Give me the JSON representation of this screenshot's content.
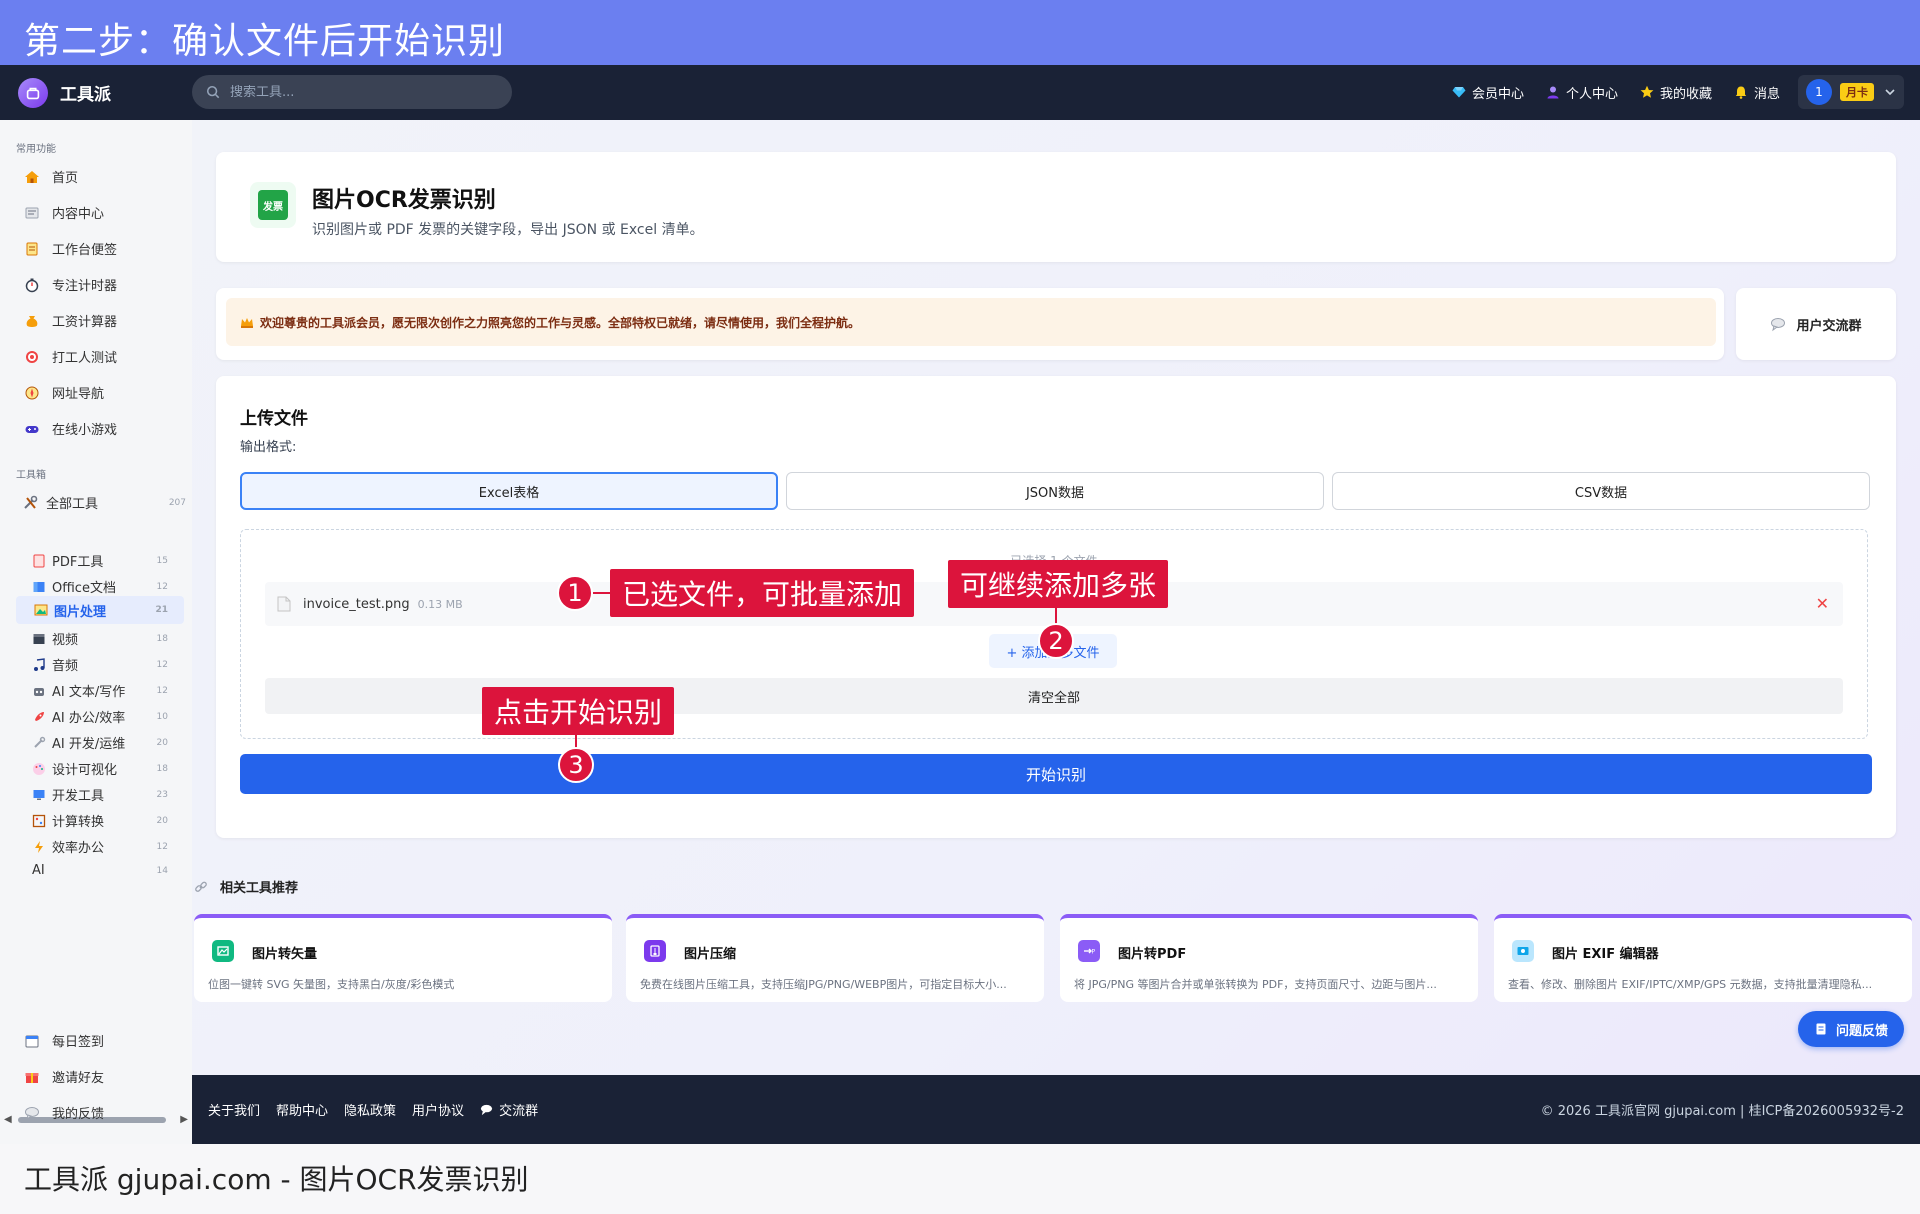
{
  "banner": {
    "text": "第二步：确认文件后开始识别"
  },
  "caption": {
    "text": "工具派 gjupai.com - 图片OCR发票识别"
  },
  "topnav": {
    "logo_text": "工具派",
    "search_placeholder": "搜索工具...",
    "items": [
      {
        "label": "会员中心",
        "icon": "diamond-icon",
        "color": "#38bdf8"
      },
      {
        "label": "个人中心",
        "icon": "user-icon",
        "color": "#a78bfa"
      },
      {
        "label": "我的收藏",
        "icon": "star-icon",
        "color": "#facc15"
      },
      {
        "label": "消息",
        "icon": "bell-icon",
        "color": "#facc15"
      }
    ],
    "user_avatar": "1",
    "membership_badge": "月卡"
  },
  "sidebar": {
    "common_section": "常用功能",
    "common": [
      {
        "label": "首页",
        "icon": "home-icon"
      },
      {
        "label": "内容中心",
        "icon": "newspaper-icon"
      },
      {
        "label": "工作台便签",
        "icon": "memo-icon"
      },
      {
        "label": "专注计时器",
        "icon": "stopwatch-icon"
      },
      {
        "label": "工资计算器",
        "icon": "money-bag-icon"
      },
      {
        "label": "打工人测试",
        "icon": "target-icon"
      },
      {
        "label": "网址导航",
        "icon": "compass-icon"
      },
      {
        "label": "在线小游戏",
        "icon": "gamepad-icon"
      }
    ],
    "toolbox_section": "工具箱",
    "all_tools": {
      "label": "全部工具",
      "count": "207"
    },
    "categories": [
      {
        "label": "PDF工具",
        "count": "15",
        "icon": "pdf-icon"
      },
      {
        "label": "Office文档",
        "count": "12",
        "icon": "office-icon"
      },
      {
        "label": "图片处理",
        "count": "21",
        "icon": "image-icon"
      },
      {
        "label": "视频",
        "count": "18",
        "icon": "clapper-icon"
      },
      {
        "label": "音频",
        "count": "12",
        "icon": "music-icon"
      },
      {
        "label": "AI 文本/写作",
        "count": "12",
        "icon": "robot-icon"
      },
      {
        "label": "AI 办公/效率",
        "count": "10",
        "icon": "rocket-icon"
      },
      {
        "label": "AI 开发/运维",
        "count": "20",
        "icon": "wrench-icon"
      },
      {
        "label": "设计可视化",
        "count": "18",
        "icon": "palette-icon"
      },
      {
        "label": "开发工具",
        "count": "23",
        "icon": "monitor-icon"
      },
      {
        "label": "计算转换",
        "count": "20",
        "icon": "abacus-icon"
      },
      {
        "label": "效率办公",
        "count": "12",
        "icon": "lightning-icon"
      },
      {
        "label": "AI",
        "count": "14",
        "icon": ""
      }
    ],
    "bottom": [
      {
        "label": "每日签到",
        "icon": "calendar-icon"
      },
      {
        "label": "邀请好友",
        "icon": "gift-icon"
      },
      {
        "label": "我的反馈",
        "icon": "chat-bubble-icon"
      }
    ]
  },
  "tool": {
    "icon_text": "发票",
    "title": "图片OCR发票识别",
    "description": "识别图片或 PDF 发票的关键字段，导出 JSON 或 Excel 清单。"
  },
  "welcome": {
    "text": "欢迎尊贵的工具派会员，愿无限次创作之力照亮您的工作与灵感。全部特权已就绪，请尽情使用，我们全程护航。",
    "group_button": "用户交流群"
  },
  "upload": {
    "title": "上传文件",
    "format_label": "输出格式:",
    "formats": [
      "Excel表格",
      "JSON数据",
      "CSV数据"
    ],
    "selected_format": "Excel表格",
    "dropzone_hint": "已选择 1 个文件",
    "file": {
      "name": "invoice_test.png",
      "size": "0.13 MB"
    },
    "add_more": "+ 添加更多文件",
    "clear_all": "清空全部",
    "start": "开始识别"
  },
  "related": {
    "title": "相关工具推荐",
    "items": [
      {
        "title": "图片转矢量",
        "desc": "位图一键转 SVG 矢量图，支持黑白/灰度/彩色模式",
        "icon": "vector-icon",
        "color": "#10b981"
      },
      {
        "title": "图片压缩",
        "desc": "免费在线图片压缩工具，支持压缩JPG/PNG/WEBP图片，可指定目标大小...",
        "icon": "compress-icon",
        "color": "#7c3aed"
      },
      {
        "title": "图片转PDF",
        "desc": "将 JPG/PNG 等图片合并或单张转换为 PDF，支持页面尺寸、边距与图片...",
        "icon": "image-to-pdf-icon",
        "color": "#8b5cf6"
      },
      {
        "title": "图片 EXIF 编辑器",
        "desc": "查看、修改、删除图片 EXIF/IPTC/XMP/GPS 元数据，支持批量清理隐私...",
        "icon": "photo-exif-icon",
        "color": "#0ea5e9"
      }
    ]
  },
  "feedback_button": "问题反馈",
  "footer": {
    "links": [
      "关于我们",
      "帮助中心",
      "隐私政策",
      "用户协议"
    ],
    "group": "交流群",
    "copyright": "© 2026 工具派官网 gjupai.com | 桂ICP备2026005932号-2"
  },
  "annotations": [
    {
      "number": "1",
      "label": "已选文件，可批量添加"
    },
    {
      "number": "2",
      "label": "可继续添加多张"
    },
    {
      "number": "3",
      "label": "点击开始识别"
    }
  ]
}
